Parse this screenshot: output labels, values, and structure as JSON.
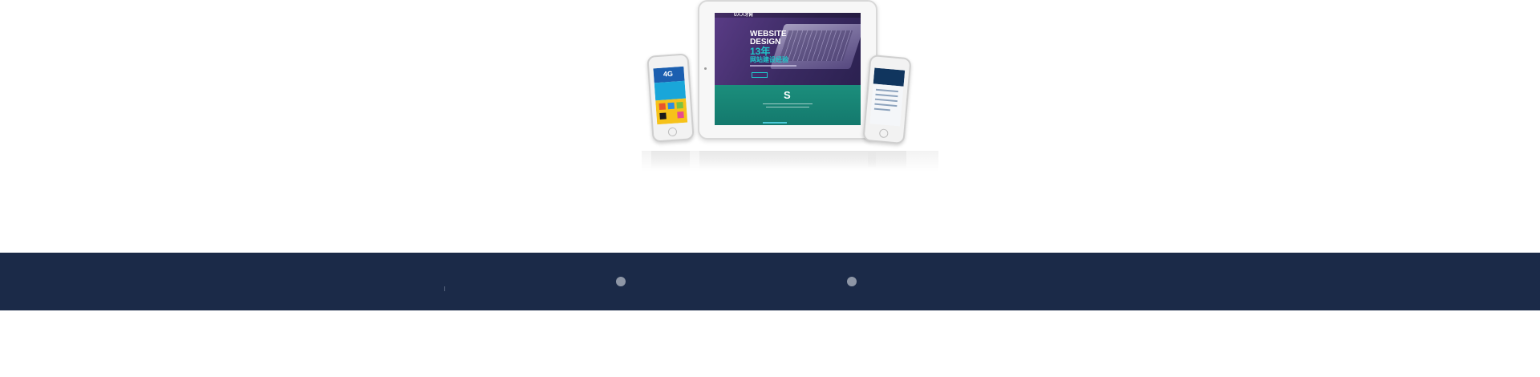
{
  "hero": {
    "tablet_screen": {
      "brand": "U人人才网",
      "title_line1": "WEBSITE",
      "title_line2": "DESIGN",
      "number": "13年",
      "headline_cn": "网站建设经验",
      "section_letter": "S"
    },
    "phone_left": {
      "badge": "4G"
    }
  },
  "band": {
    "background": "#1b2a48",
    "dot_color": "#8e96a6",
    "dots": 2
  }
}
